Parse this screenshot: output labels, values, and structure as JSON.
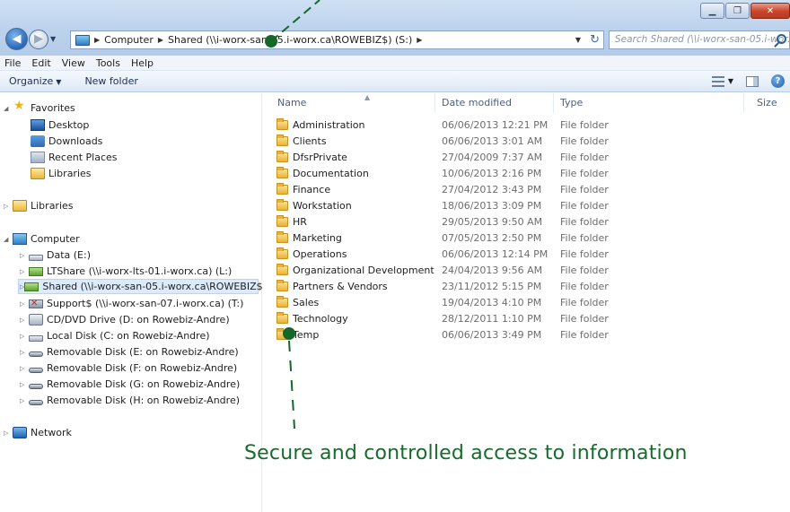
{
  "titlebar": {
    "controls": [
      "minimize",
      "maximize",
      "close"
    ]
  },
  "address": {
    "crumbs": [
      "Computer",
      "Shared (\\\\i-worx-san-05.i-worx.ca\\ROWEBIZ$) (S:)"
    ]
  },
  "search": {
    "placeholder": "Search Shared (\\\\i-worx-san-05.i-worx..."
  },
  "menubar": {
    "items": [
      "File",
      "Edit",
      "View",
      "Tools",
      "Help"
    ]
  },
  "commandbar": {
    "organize": "Organize",
    "new_folder": "New folder"
  },
  "navpane": {
    "favorites": "Favorites",
    "favorite_items": [
      "Desktop",
      "Downloads",
      "Recent Places",
      "Libraries"
    ],
    "libraries": "Libraries",
    "computer": "Computer",
    "drives": [
      "Data (E:)",
      "LTShare (\\\\i-worx-lts-01.i-worx.ca) (L:)",
      "Shared (\\\\i-worx-san-05.i-worx.ca\\ROWEBIZ$) (S:)",
      "Support$ (\\\\i-worx-san-07.i-worx.ca) (T:)",
      "CD/DVD Drive (D: on Rowebiz-Andre)",
      "Local Disk (C: on Rowebiz-Andre)",
      "Removable Disk (E: on Rowebiz-Andre)",
      "Removable Disk (F: on Rowebiz-Andre)",
      "Removable Disk (G: on Rowebiz-Andre)",
      "Removable Disk (H: on Rowebiz-Andre)"
    ],
    "network": "Network"
  },
  "filelist": {
    "columns": {
      "name": "Name",
      "date": "Date modified",
      "type": "Type",
      "size": "Size"
    },
    "rows": [
      {
        "name": "Administration",
        "date": "06/06/2013 12:21 PM",
        "type": "File folder"
      },
      {
        "name": "Clients",
        "date": "06/06/2013 3:01 AM",
        "type": "File folder"
      },
      {
        "name": "DfsrPrivate",
        "date": "27/04/2009 7:37 AM",
        "type": "File folder"
      },
      {
        "name": "Documentation",
        "date": "10/06/2013 2:16 PM",
        "type": "File folder"
      },
      {
        "name": "Finance",
        "date": "27/04/2012 3:43 PM",
        "type": "File folder"
      },
      {
        "name": "Workstation",
        "date": "18/06/2013 3:09 PM",
        "type": "File folder"
      },
      {
        "name": "HR",
        "date": "29/05/2013 9:50 AM",
        "type": "File folder"
      },
      {
        "name": "Marketing",
        "date": "07/05/2013 2:50 PM",
        "type": "File folder"
      },
      {
        "name": "Operations",
        "date": "06/06/2013 12:14 PM",
        "type": "File folder"
      },
      {
        "name": "Organizational Development",
        "date": "24/04/2013 9:56 AM",
        "type": "File folder"
      },
      {
        "name": "Partners & Vendors",
        "date": "23/11/2012 5:15 PM",
        "type": "File folder"
      },
      {
        "name": "Sales",
        "date": "19/04/2013 4:10 PM",
        "type": "File folder"
      },
      {
        "name": "Technology",
        "date": "28/12/2011 1:10 PM",
        "type": "File folder"
      },
      {
        "name": "Temp",
        "date": "06/06/2013 3:49 PM",
        "type": "File folder"
      }
    ]
  },
  "annotation": {
    "caption": "Secure and controlled access to information",
    "color": "#14682a"
  },
  "colors": {
    "selection": "#dcebfc",
    "folder": "#e9b23c",
    "caption": "#176b2c"
  }
}
